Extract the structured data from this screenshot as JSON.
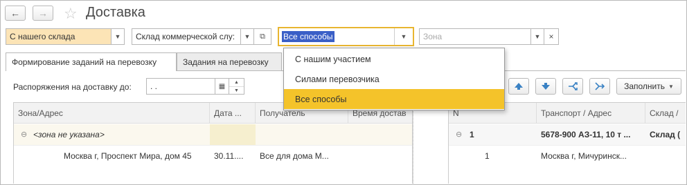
{
  "window": {
    "title": "Доставка"
  },
  "filters": {
    "source": "С нашего склада",
    "warehouse": "Склад коммерческой слу:",
    "method": "Все способы",
    "zone_placeholder": "Зона"
  },
  "dropdown": {
    "options": [
      "С нашим участием",
      "Силами перевозчика",
      "Все способы"
    ]
  },
  "tabs": [
    {
      "label": "Формирование заданий на перевозку"
    },
    {
      "label": "Задания на перевозку"
    }
  ],
  "orders_filter": {
    "label": "Распоряжения на доставку до:",
    "value": ". ."
  },
  "toolbar": {
    "fill_label": "Заполнить"
  },
  "left_grid": {
    "headers": [
      "Зона/Адрес",
      "Дата ...",
      "Получатель",
      "Время достав"
    ],
    "group_row": "<зона не указана>",
    "data_row": [
      "Москва г, Проспект Мира, дом 45",
      "30.11....",
      "Все для дома М..."
    ]
  },
  "right_grid": {
    "headers": [
      "N",
      "Транспорт / Адрес",
      "Склад /"
    ],
    "group_row": [
      "1",
      "5678-900 АЗ-11, 10 т ...",
      "Склад ("
    ],
    "data_row": [
      "1",
      "Москва г, Мичуринск..."
    ]
  },
  "colors": {
    "selected_option": "#f4c32a",
    "source_field_bg": "#fce4b6",
    "focus_border": "#e8b530"
  }
}
